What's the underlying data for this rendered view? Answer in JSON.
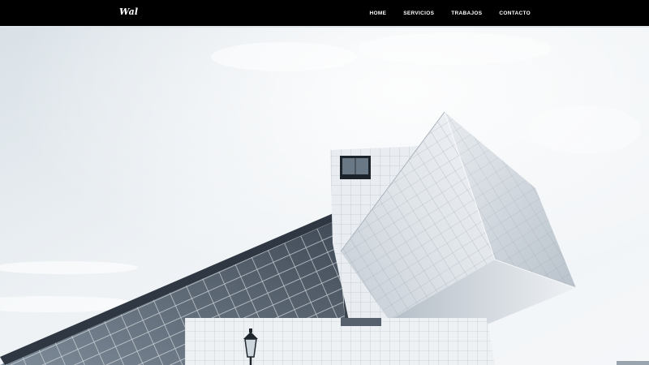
{
  "header": {
    "logo_text": "Wal"
  },
  "nav": {
    "items": [
      {
        "label": "HOME"
      },
      {
        "label": "SERVICIOS"
      },
      {
        "label": "TRABAJOS"
      },
      {
        "label": "CONTACTO"
      }
    ]
  },
  "colors": {
    "navbar_bg": "#000000",
    "nav_text": "#ffffff",
    "sky_light": "#f4f6f8",
    "sky_mid": "#d8e0e6",
    "facade_light": "#eef1f4",
    "facade_mid": "#c9d0d8",
    "glass_dark": "#4d5864"
  },
  "icons": {
    "logo": "script-logo",
    "lamp": "street-lamp"
  }
}
